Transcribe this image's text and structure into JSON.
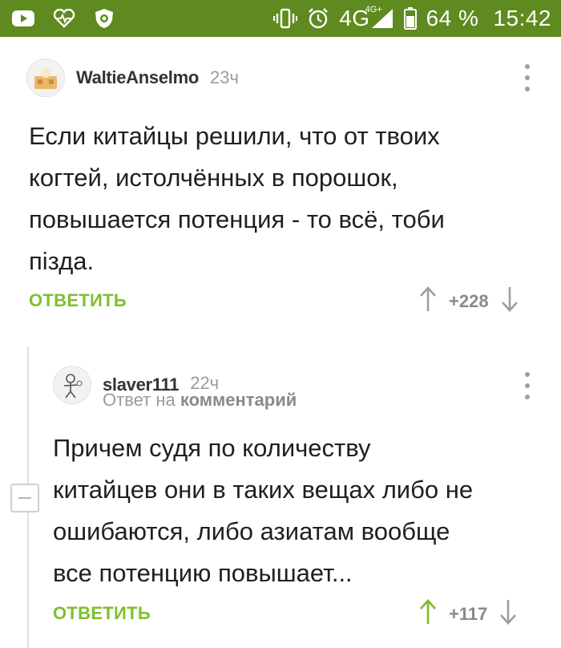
{
  "status_bar": {
    "network": "4G",
    "network_sup": "4G+",
    "battery": "64 %",
    "time": "15:42",
    "icons": [
      "youtube-icon",
      "heart-rate-icon",
      "shield-app-icon",
      "vibrate-icon",
      "alarm-icon",
      "signal-icon",
      "battery-icon"
    ]
  },
  "comments": [
    {
      "username": "WaltieAnselmo",
      "time": "23ч",
      "body_lines": [
        "Если китайцы решили, что от твоих",
        "когтей, истолчённых в порошок,",
        "повышается потенция - то всё, тоби",
        "пiзда."
      ],
      "reply_label": "ОТВЕТИТЬ",
      "votes": "+228"
    },
    {
      "username": "slaver111",
      "time": "22ч",
      "reply_prefix": "Ответ на",
      "reply_target": "комментарий",
      "body_lines": [
        "Причем судя по количеству",
        "китайцев они в таких вещах либо не",
        "ошибаются, либо азиатам вообще",
        "все потенцию повышает..."
      ],
      "reply_label": "ОТВЕТИТЬ",
      "votes": "+117"
    }
  ],
  "colors": {
    "status_bar": "#5f8a1f",
    "accent_green": "#7fbf2f",
    "muted": "#9b9b9b"
  }
}
